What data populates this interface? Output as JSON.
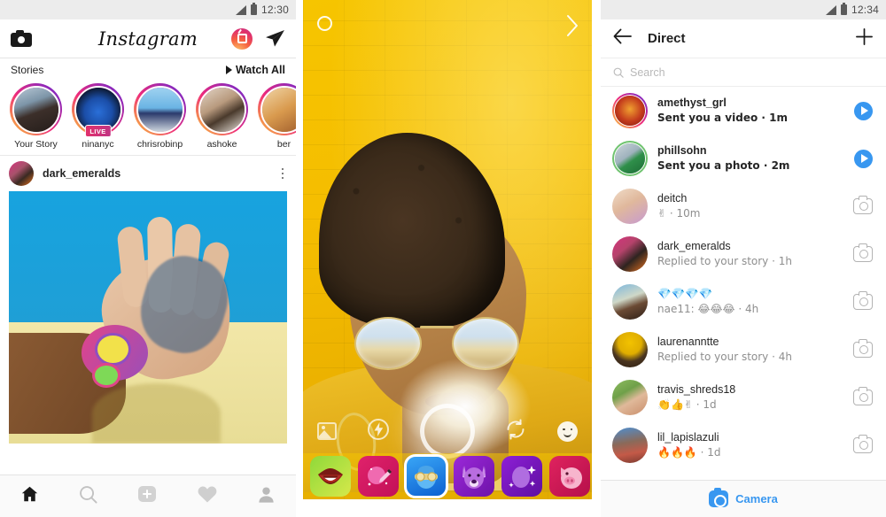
{
  "feed": {
    "status_bar": {
      "time": "12:30",
      "signal_icon": "signal-icon",
      "battery_icon": "battery-icon"
    },
    "appbar": {
      "camera_icon": "camera-icon",
      "logo": "Instagram",
      "igtv_icon": "igtv-icon",
      "direct_icon": "send-icon"
    },
    "stories_header": {
      "label": "Stories",
      "watch_all": "Watch All"
    },
    "stories": [
      {
        "name": "Your Story",
        "live": false
      },
      {
        "name": "ninanyc",
        "live": true,
        "live_label": "LIVE"
      },
      {
        "name": "chrisrobinp",
        "live": false
      },
      {
        "name": "ashoke",
        "live": false
      },
      {
        "name": "ber",
        "live": false
      }
    ],
    "post": {
      "username": "dark_emeralds",
      "more_icon": "more-options-icon"
    },
    "tabbar": [
      {
        "name": "home-icon",
        "active": true
      },
      {
        "name": "search-icon",
        "active": false
      },
      {
        "name": "add-post-icon",
        "active": false
      },
      {
        "name": "activity-heart-icon",
        "active": false
      },
      {
        "name": "profile-icon",
        "active": false
      }
    ]
  },
  "camera": {
    "settings_icon": "camera-settings-icon",
    "next_icon": "chevron-right-icon",
    "controls": {
      "gallery_icon": "gallery-icon",
      "flash_icon": "flash-icon",
      "shutter_icon": "shutter-button",
      "flip_icon": "flip-camera-icon",
      "face_filter_icon": "face-filter-icon"
    },
    "filters": [
      {
        "name": "lips-filter",
        "selected": false,
        "bg_from": "#8fd93a",
        "bg_to": "#d6e84a",
        "glyph": "lips"
      },
      {
        "name": "makeup-filter",
        "selected": false,
        "bg_from": "#e0226b",
        "bg_to": "#c21057",
        "glyph": "brush"
      },
      {
        "name": "sunglasses-filter",
        "selected": true,
        "bg_from": "#1f8ff0",
        "bg_to": "#0b5fd0",
        "glyph": "sunglasses"
      },
      {
        "name": "dog-filter",
        "selected": false,
        "bg_from": "#9b28d9",
        "bg_to": "#6d12a8",
        "glyph": "dog"
      },
      {
        "name": "sparkle-filter",
        "selected": false,
        "bg_from": "#8e1fd6",
        "bg_to": "#5e0fa0",
        "glyph": "sparkle"
      },
      {
        "name": "pig-filter",
        "selected": false,
        "bg_from": "#e0225f",
        "bg_to": "#b5104a",
        "glyph": "pig"
      }
    ]
  },
  "direct": {
    "status_bar": {
      "time": "12:34",
      "signal_icon": "signal-icon",
      "battery_icon": "battery-icon"
    },
    "appbar": {
      "back_icon": "back-arrow-icon",
      "title": "Direct",
      "new_message_icon": "plus-icon"
    },
    "search": {
      "placeholder": "Search",
      "icon": "search-icon"
    },
    "threads": [
      {
        "user": "amethyst_grl",
        "preview": "Sent you a video · 1m",
        "unread": true,
        "ring": "gradient",
        "action": "play",
        "av_from": "#b62a1e",
        "av_to": "#e8671f"
      },
      {
        "user": "phillsohn",
        "preview": "Sent you a photo · 2m",
        "unread": true,
        "ring": "green",
        "action": "play",
        "av_from": "#9fb2bd",
        "av_to": "#2f8f4a"
      },
      {
        "user": "deitch",
        "preview": "✌ · 10m",
        "unread": false,
        "ring": "none",
        "action": "camera",
        "av_from": "#e8c9b8",
        "av_to": "#c79ad0"
      },
      {
        "user": "dark_emeralds",
        "preview": "Replied to your story · 1h",
        "unread": false,
        "ring": "none",
        "action": "camera",
        "av_from": "#d6337e",
        "av_to": "#e8721f"
      },
      {
        "user": "💎💎💎💎",
        "preview": "nae11: 😂😂😂  · 4h",
        "unread": false,
        "ring": "none",
        "action": "camera",
        "av_from": "#7ab6dd",
        "av_to": "#4a3b2e"
      },
      {
        "user": "laurenanntte",
        "preview": "Replied to your story · 4h",
        "unread": false,
        "ring": "none",
        "action": "camera",
        "av_from": "#f2c200",
        "av_to": "#6b4a22"
      },
      {
        "user": "travis_shreds18",
        "preview": "👏👍✌  · 1d",
        "unread": false,
        "ring": "none",
        "action": "camera",
        "av_from": "#7fae52",
        "av_to": "#d3a184"
      },
      {
        "user": "lil_lapislazuli",
        "preview": "🔥🔥🔥  · 1d",
        "unread": false,
        "ring": "none",
        "action": "camera",
        "av_from": "#3f7fc4",
        "av_to": "#b85a4a"
      }
    ],
    "footer": {
      "icon": "camera-icon",
      "label": "Camera"
    }
  },
  "colors": {
    "instagram_blue": "#3897f0",
    "story_ring_gradient_start": "#f9ce34",
    "story_ring_gradient_mid": "#ee2a7b",
    "story_ring_gradient_end": "#6228d7",
    "text_primary": "#262626",
    "text_secondary": "#8e8e8e",
    "camera_wall_yellow": "#f5c500"
  }
}
